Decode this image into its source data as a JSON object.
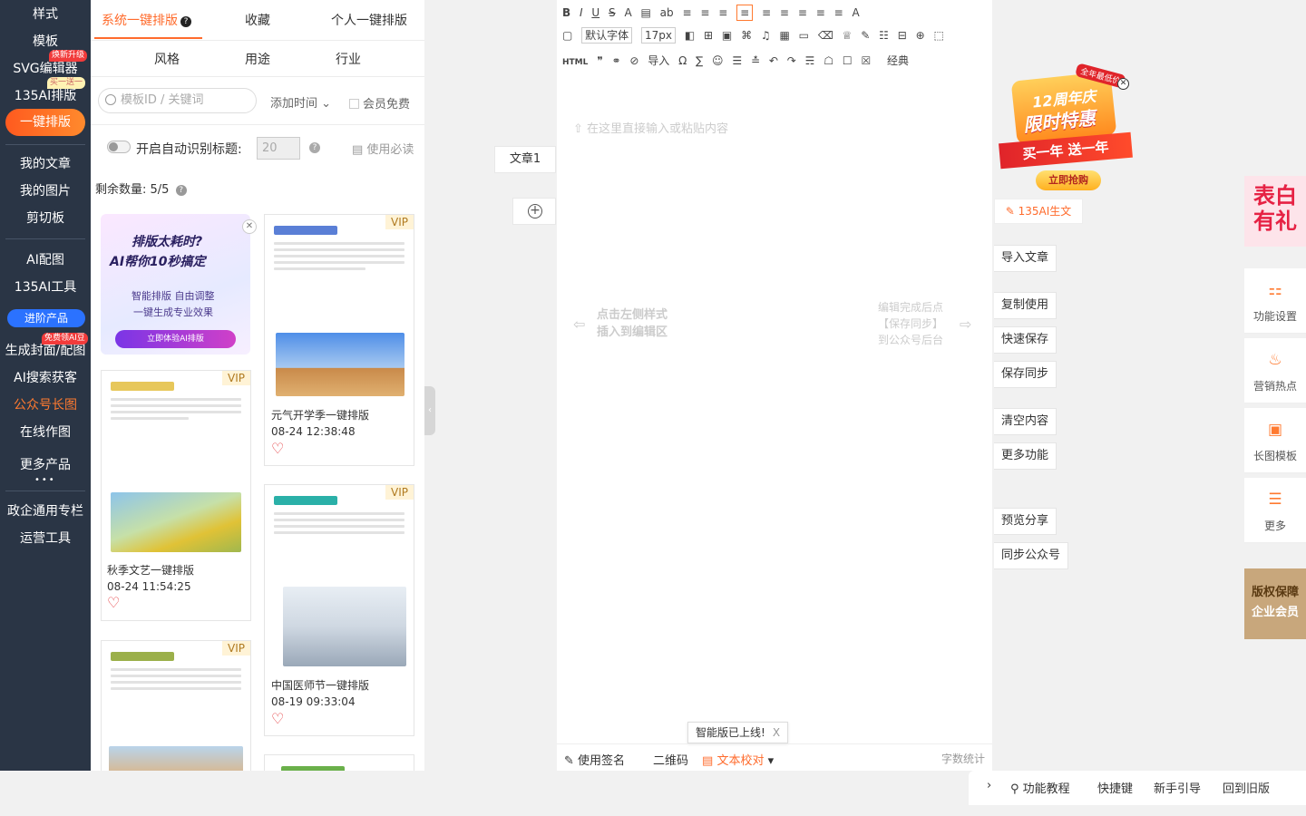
{
  "leftnav": {
    "items": [
      {
        "label": "样式"
      },
      {
        "label": "模板"
      },
      {
        "label": "SVG编辑器",
        "badge": "焕新升级"
      },
      {
        "label": "135AI排版",
        "badge": "买一送一"
      },
      {
        "label": "一键排版"
      },
      {
        "label": "我的文章"
      },
      {
        "label": "我的图片"
      },
      {
        "label": "剪切板"
      },
      {
        "label": "AI配图"
      },
      {
        "label": "135AI工具"
      },
      {
        "label": "进阶产品"
      },
      {
        "label": "生成封面/配图",
        "badge": "免费领AI豆"
      },
      {
        "label": "AI搜索获客"
      },
      {
        "label": "公众号长图"
      },
      {
        "label": "在线作图"
      },
      {
        "label": "更多产品"
      },
      {
        "label": "政企通用专栏"
      },
      {
        "label": "运营工具"
      }
    ],
    "dots": "•••"
  },
  "template_panel": {
    "tabs": [
      {
        "label": "系统一键排版"
      },
      {
        "label": "收藏"
      },
      {
        "label": "个人一键排版"
      }
    ],
    "help_glyph": "?",
    "subtabs": [
      {
        "label": "风格"
      },
      {
        "label": "用途"
      },
      {
        "label": "行业"
      }
    ],
    "search_placeholder": "模板ID / 关键词",
    "sort_label": "添加时间",
    "sort_caret": "⌄",
    "member_free_label": "会员免费",
    "auto_title_label": "开启自动识别标题:",
    "auto_title_value": "20",
    "guide_label": "使用必读",
    "remain_label": "剩余数量: 5/5",
    "ai_promo": {
      "line1": "排版太耗时?",
      "line2": "AI帮你10秒搞定",
      "line3": "智能排版 自由调整",
      "line4": "一键生成专业效果",
      "button": "立即体验AI排版",
      "close": "✕"
    },
    "vip_label": "VIP",
    "heart_glyph": "♡",
    "cards": [
      {
        "title": "元气开学季一键排版",
        "date": "08-24 12:38:48"
      },
      {
        "title": "秋季文艺一键排版",
        "date": "08-24 11:54:25"
      },
      {
        "title": "中国医师节一键排版",
        "date": "08-19 09:33:04"
      }
    ]
  },
  "collapse_glyph": "‹",
  "doc_tab": {
    "label": "文章1"
  },
  "add_glyph": "+",
  "toolbar": {
    "row1": [
      "B",
      "I",
      "U",
      "S",
      "A",
      "▤",
      "ab",
      "≡",
      "≡",
      "≡",
      "≡",
      "≡",
      "≡",
      "≡",
      "≡",
      "≡",
      "A"
    ],
    "font_family": "默认字体",
    "font_size": "17px",
    "row2": [
      "◧",
      "⊞",
      "▣",
      "⌘",
      "♫",
      "▦",
      "▭",
      "⌫",
      "♕",
      "✎",
      "☷",
      "⊟",
      "⊕",
      "⬚"
    ],
    "row3": [
      "HTML",
      "❞",
      "⚭",
      "⊘",
      "导入",
      "Ω",
      "∑",
      "☺",
      "☰",
      "≛",
      "↶",
      "↷",
      "☴",
      "☖",
      "☐",
      "☒"
    ],
    "classic_label": "经典"
  },
  "editor": {
    "placeholder": "在这里直接输入或粘贴内容",
    "hint_left_1": "点击左侧样式",
    "hint_left_2": "插入到编辑区",
    "hint_right_1": "编辑完成后点",
    "hint_right_2": "【保存同步】",
    "hint_right_3": "到公众号后台",
    "arrow_left": "⇦",
    "arrow_right": "⇨",
    "toast": "智能版已上线!",
    "toast_close": "X",
    "bottom": {
      "signature": "使用签名",
      "qrcode": "二维码",
      "proofread": "文本校对",
      "word_count": "字数统计",
      "pen": "✎",
      "doc": "▤",
      "caret": "▾"
    }
  },
  "promo": {
    "tag": "全年最低价",
    "line1": "12周年庆",
    "line2": "限时特惠",
    "ribbon": "买一年 送一年",
    "button": "立即抢购",
    "close": "✕"
  },
  "ai_write": "135AI生文",
  "actions": [
    {
      "label": "导入文章"
    },
    {
      "label": "复制使用"
    },
    {
      "label": "快速保存"
    },
    {
      "label": "保存同步"
    },
    {
      "label": "清空内容"
    },
    {
      "label": "更多功能"
    },
    {
      "label": "预览分享"
    },
    {
      "label": "同步公众号"
    }
  ],
  "gift": "表白有礼",
  "right_tools": [
    {
      "label": "功能设置",
      "icon": "grid-icon",
      "glyph": "⚏"
    },
    {
      "label": "营销热点",
      "icon": "flame-icon",
      "glyph": "♨"
    },
    {
      "label": "长图模板",
      "icon": "image-icon",
      "glyph": "▣"
    },
    {
      "label": "更多",
      "icon": "menu-icon",
      "glyph": "☰"
    }
  ],
  "copyright": {
    "line1": "版权保障",
    "line2": "企业会员"
  },
  "helpbar": {
    "caret": "›",
    "tutorial": "功能教程",
    "hotkeys": "快捷键",
    "newbie": "新手引导",
    "old": "回到旧版"
  },
  "colors": {
    "accent": "#ff6b2c",
    "nav_bg": "#2a3545"
  }
}
